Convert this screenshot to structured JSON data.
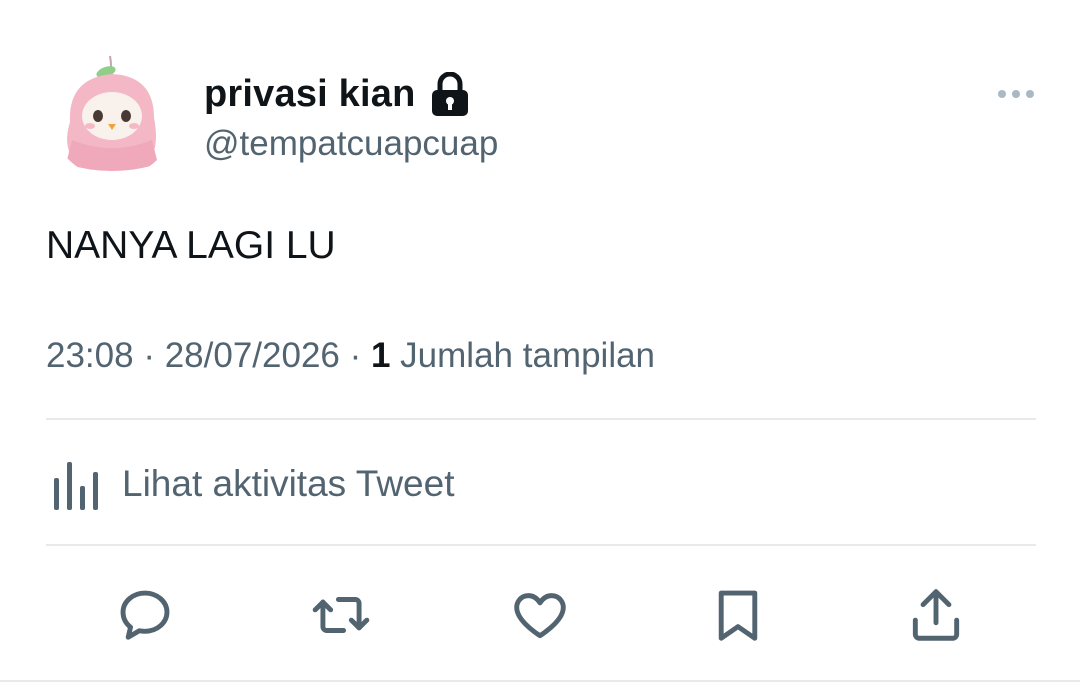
{
  "author": {
    "display_name": "privasi kian",
    "handle": "@tempatcuapcuap",
    "avatar_icon": "pink-hooded-plush-avatar",
    "protected_icon": "lock-icon"
  },
  "tweet": {
    "text": "NANYA LAGI LU"
  },
  "meta": {
    "time": "23:08",
    "sep1": " · ",
    "date": "28/07/2026",
    "sep2": " · ",
    "views_count": "1",
    "views_label": " Jumlah tampilan"
  },
  "activity": {
    "label": "Lihat aktivitas Tweet",
    "icon": "analytics-bars-icon"
  },
  "actions": [
    {
      "icon": "reply-icon"
    },
    {
      "icon": "retweet-icon"
    },
    {
      "icon": "like-icon"
    },
    {
      "icon": "bookmark-icon"
    },
    {
      "icon": "share-icon"
    }
  ],
  "colors": {
    "text_primary": "#0f1419",
    "text_secondary": "#536471",
    "divider": "#e6eaed",
    "icon_gray": "#536471"
  }
}
